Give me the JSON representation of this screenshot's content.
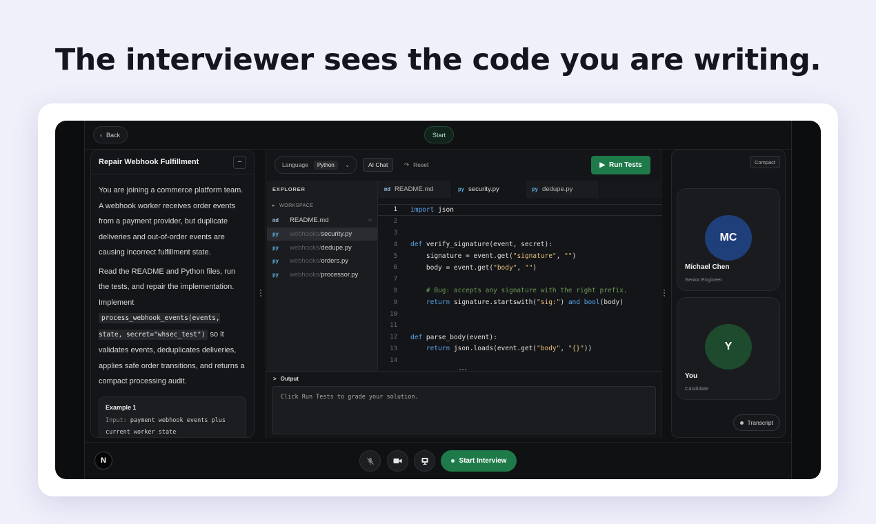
{
  "headline": "The interviewer sees the code you are writing.",
  "topbar": {
    "back_label": "Back",
    "start_label": "Start"
  },
  "problem": {
    "title": "Repair Webhook Fulfillment",
    "collapse_symbol": "−",
    "para1": "You are joining a commerce platform team. A webhook worker receives order events from a payment provider, but duplicate deliveries and out-of-order events are causing incorrect fulfillment state.",
    "para2_before": "Read the README and Python files, run the tests, and repair the implementation. Implement ",
    "para2_code": "process_webhook_events(events, state, secret=\"whsec_test\")",
    "para2_after": " so it validates events, deduplicates deliveries, applies safe order transitions, and returns a compact processing audit.",
    "example_title": "Example 1",
    "example_label": "Input:",
    "example_text": "payment webhook events plus current worker state"
  },
  "toolbar": {
    "language_label": "Language",
    "language_value": "Python",
    "ai_chat_label": "AI Chat",
    "reset_label": "Reset",
    "run_tests_label": "Run Tests"
  },
  "explorer": {
    "title": "EXPLORER",
    "workspace_label": "WORKSPACE",
    "files": [
      {
        "type": "md",
        "dir": "",
        "name": "README.md",
        "flag": "ro"
      },
      {
        "type": "py",
        "dir": "webhooks/",
        "name": "security.py",
        "flag": ""
      },
      {
        "type": "py",
        "dir": "webhooks/",
        "name": "dedupe.py",
        "flag": ""
      },
      {
        "type": "py",
        "dir": "webhooks/",
        "name": "orders.py",
        "flag": ""
      },
      {
        "type": "py",
        "dir": "webhooks/",
        "name": "processor.py",
        "flag": ""
      }
    ]
  },
  "tabs": [
    {
      "type": "md",
      "name": "README.md"
    },
    {
      "type": "py",
      "name": "security.py"
    },
    {
      "type": "py",
      "name": "dedupe.py"
    }
  ],
  "editor": {
    "line_numbers": [
      "1",
      "2",
      "3",
      "4",
      "5",
      "6",
      "7",
      "8",
      "9",
      "10",
      "11",
      "12",
      "13",
      "14"
    ],
    "l1_import": "import",
    "l1_mod": " json",
    "l4_def": "def",
    "l4_rest": " verify_signature(event, secret):",
    "l5_a": "    signature = event.get(",
    "l5_s1": "\"signature\"",
    "l5_b": ", ",
    "l5_s2": "\"\"",
    "l5_c": ")",
    "l6_a": "    body = event.get(",
    "l6_s1": "\"body\"",
    "l6_b": ", ",
    "l6_s2": "\"\"",
    "l6_c": ")",
    "l8_comment": "    # Bug: accepts any signature with the right prefix.",
    "l9_ret": "    return",
    "l9_a": " signature.startswith(",
    "l9_s": "\"sig:\"",
    "l9_b": ") ",
    "l9_and": "and",
    "l9_c": " ",
    "l9_bool": "bool",
    "l9_d": "(body)",
    "l12_def": "def",
    "l12_rest": " parse_body(event):",
    "l13_ret": "    return",
    "l13_a": " json.loads(event.get(",
    "l13_s1": "\"body\"",
    "l13_b": ", ",
    "l13_s2": "\"{}\"",
    "l13_c": "))"
  },
  "output": {
    "label": "Output",
    "chevron": ">",
    "text": "Click Run Tests to grade your solution."
  },
  "participants": {
    "compact_label": "Compact",
    "interviewer": {
      "initials": "MC",
      "name": "Michael Chen",
      "role": "Senior Engineer",
      "color": "#1f3f7a"
    },
    "candidate": {
      "initials": "Y",
      "name": "You",
      "role": "Candidate",
      "color": "#1e4a2e"
    },
    "transcript_label": "Transcript"
  },
  "bottombar": {
    "logo_letter": "N",
    "start_interview_label": "Start Interview"
  },
  "colors": {
    "accent_green": "#1f7a4a",
    "background": "#f0f0fb",
    "app_bg": "#0c0d0f"
  }
}
